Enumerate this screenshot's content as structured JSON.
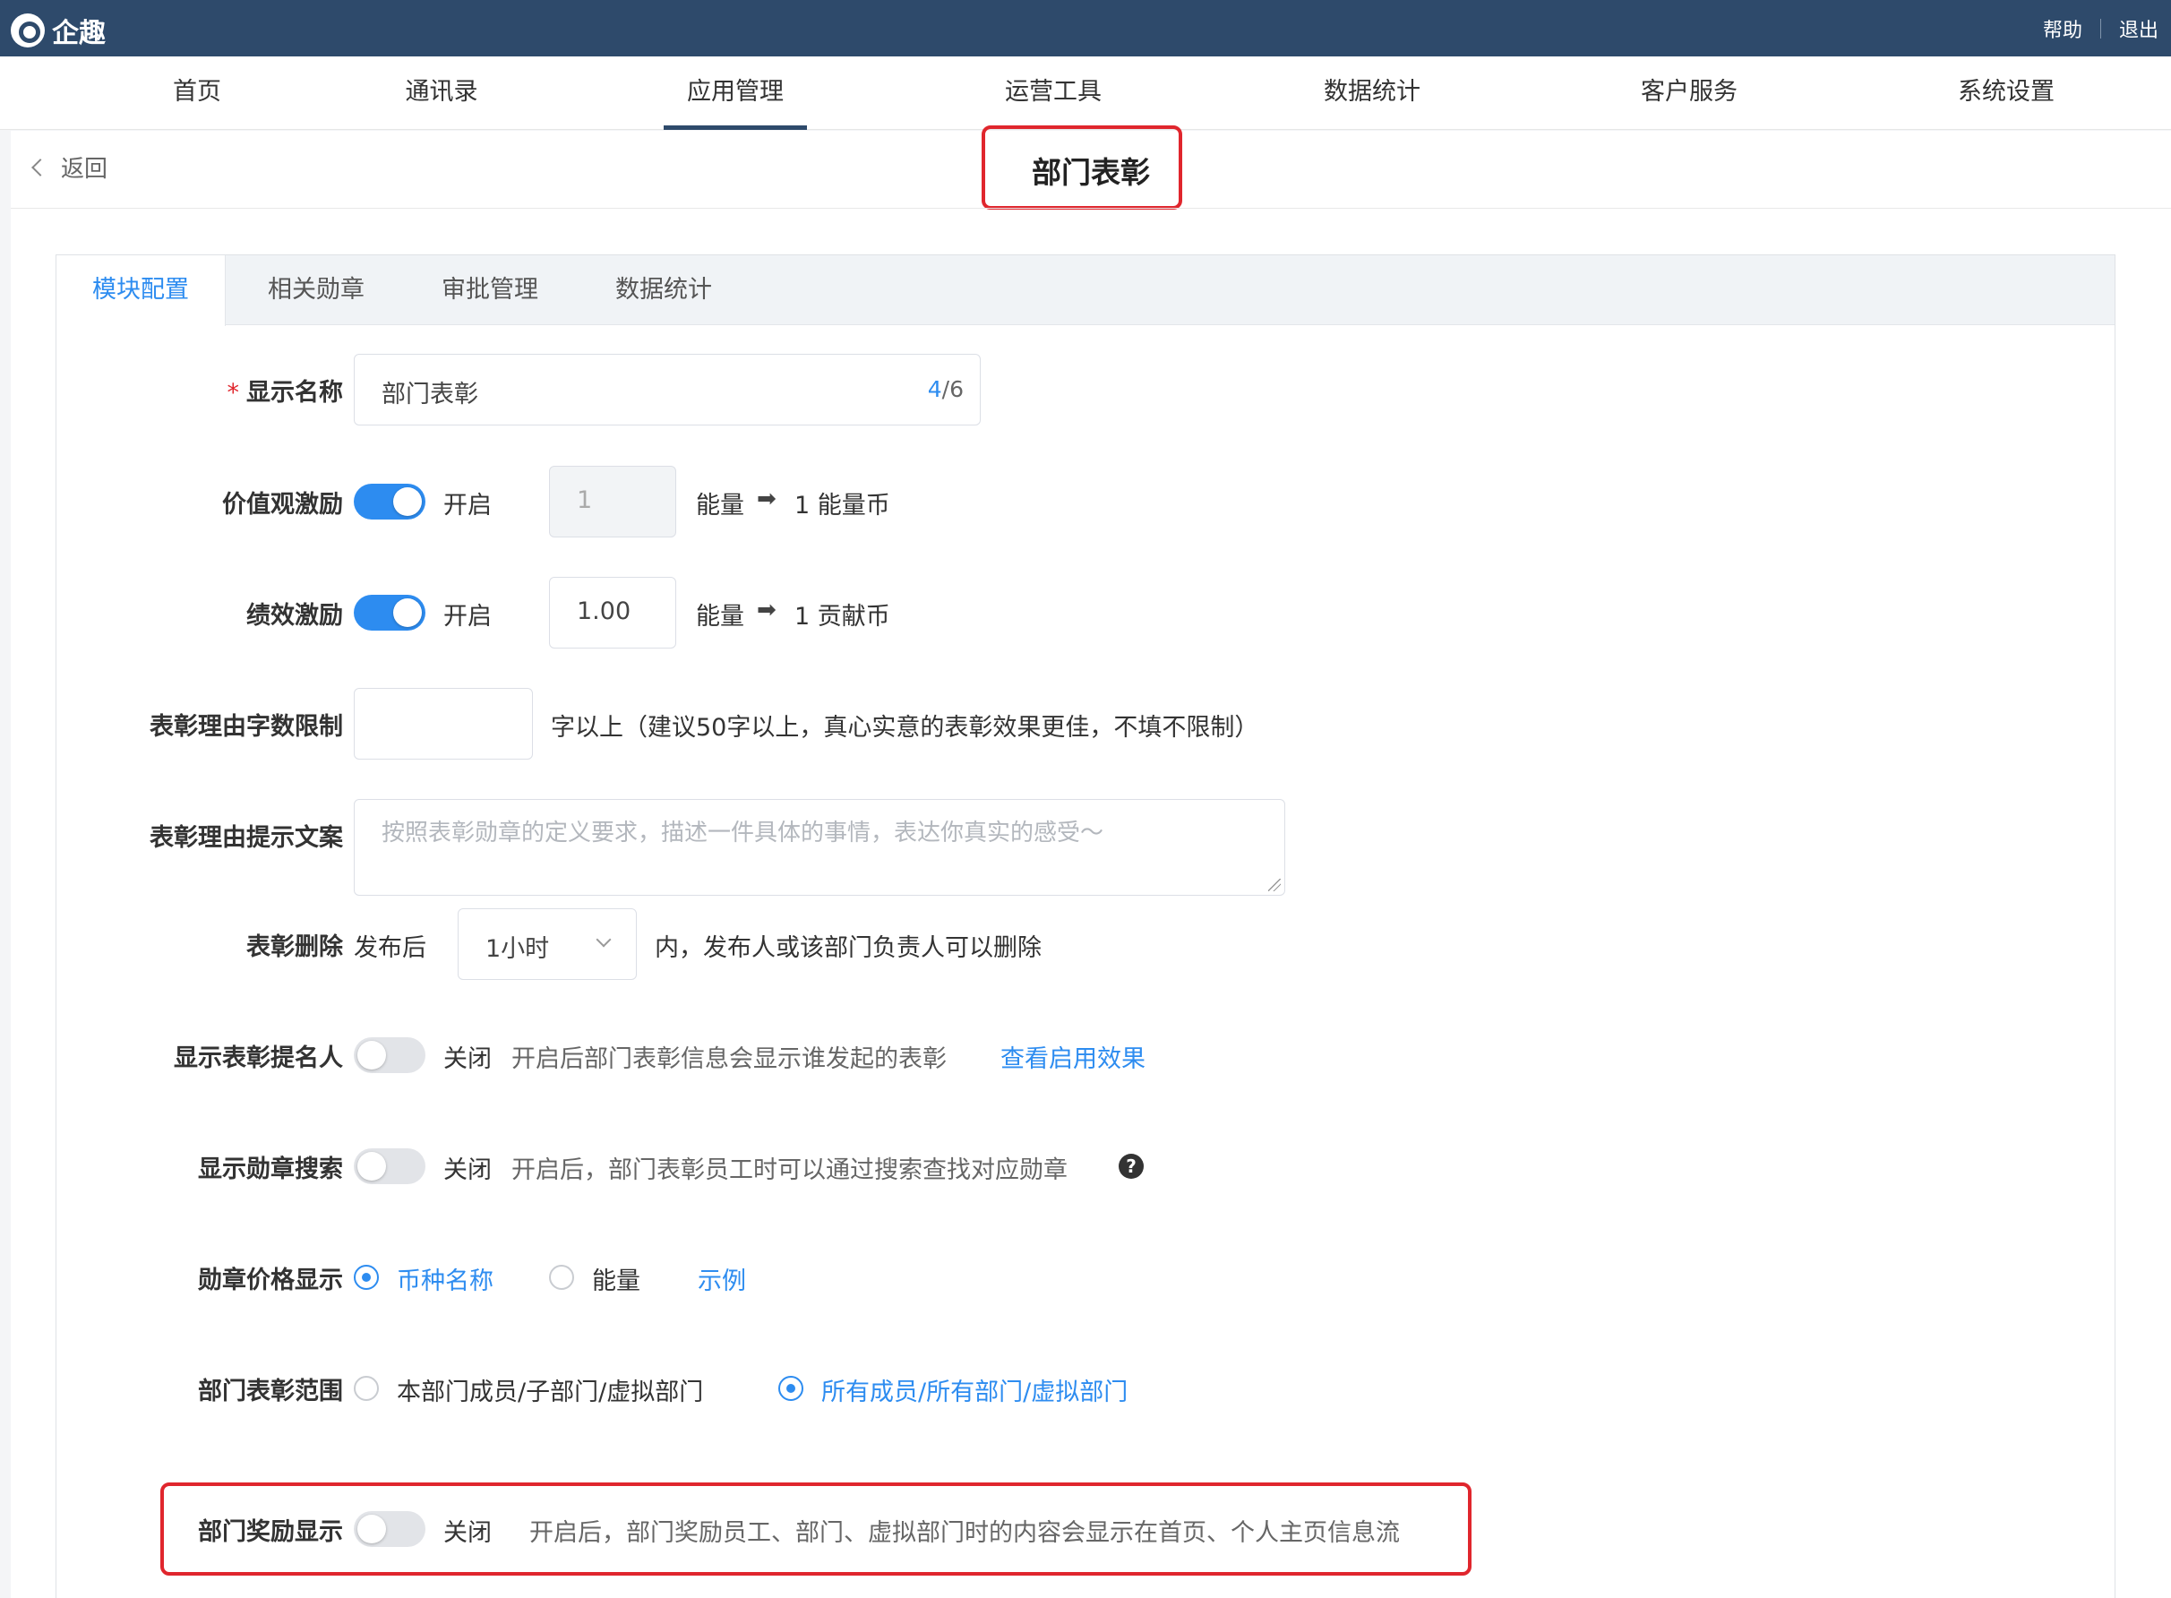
{
  "topbar": {
    "brand": "企趣",
    "help": "帮助",
    "logout": "退出"
  },
  "nav": {
    "items": [
      "首页",
      "通讯录",
      "应用管理",
      "运营工具",
      "数据统计",
      "客户服务",
      "系统设置"
    ],
    "active": "应用管理"
  },
  "header": {
    "back": "返回",
    "title": "部门表彰"
  },
  "tabs": [
    "模块配置",
    "相关勋章",
    "审批管理",
    "数据统计"
  ],
  "form": {
    "display_name": {
      "label": "显示名称",
      "value": "部门表彰",
      "count": "4",
      "max": "/6"
    },
    "value_incentive": {
      "label": "价值观激励",
      "state": "开启",
      "value": "1",
      "unit": "能量",
      "arrow": "➡",
      "result": "1 能量币"
    },
    "perf_incentive": {
      "label": "绩效激励",
      "state": "开启",
      "value": "1.00",
      "unit": "能量",
      "arrow": "➡",
      "result": "1 贡献币"
    },
    "reason_limit": {
      "label": "表彰理由字数限制",
      "value": "",
      "hint": "字以上（建议50字以上，真心实意的表彰效果更佳，不填不限制）"
    },
    "reason_prompt": {
      "label": "表彰理由提示文案",
      "placeholder": "按照表彰勋章的定义要求，描述一件具体的事情，表达你真实的感受～"
    },
    "delete": {
      "label": "表彰删除",
      "prefix": "发布后",
      "selected": "1小时",
      "suffix": "内，发布人或该部门负责人可以删除"
    },
    "show_nominator": {
      "label": "显示表彰提名人",
      "state": "关闭",
      "hint": "开启后部门表彰信息会显示谁发起的表彰",
      "link": "查看启用效果"
    },
    "show_search": {
      "label": "显示勋章搜索",
      "state": "关闭",
      "hint": "开启后，部门表彰员工时可以通过搜索查找对应勋章",
      "help": "?"
    },
    "price_display": {
      "label": "勋章价格显示",
      "opt1": "币种名称",
      "opt2": "能量",
      "link": "示例"
    },
    "scope": {
      "label": "部门表彰范围",
      "opt1": "本部门成员/子部门/虚拟部门",
      "opt2": "所有成员/所有部门/虚拟部门"
    },
    "reward_display": {
      "label": "部门奖励显示",
      "state": "关闭",
      "hint": "开启后，部门奖励员工、部门、虚拟部门时的内容会显示在首页、个人主页信息流"
    }
  },
  "colors": {
    "topbar": "#2e4a6b",
    "accent": "#2d8cf0",
    "highlight": "#e0262d"
  }
}
